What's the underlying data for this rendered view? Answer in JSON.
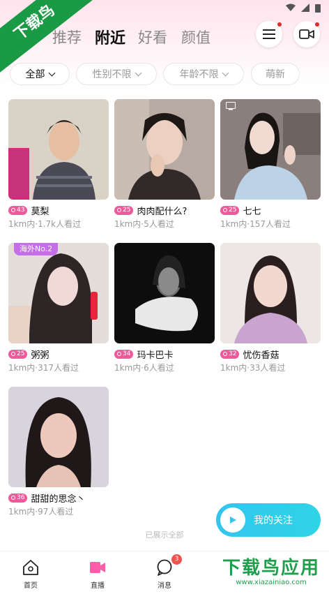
{
  "watermark_top": "下载鸟",
  "tabs": [
    "推荐",
    "附近",
    "好看",
    "颜值"
  ],
  "active_tab": "附近",
  "filters": [
    {
      "label": "全部",
      "active": true
    },
    {
      "label": "性别不限",
      "active": false
    },
    {
      "label": "年龄不限",
      "active": false
    },
    {
      "label": "萌新",
      "active": false
    }
  ],
  "cards": [
    {
      "name": "莫梨",
      "level": "43",
      "meta": "1km内·1.7k人看过",
      "tag": ""
    },
    {
      "name": "肉肉配什么?",
      "level": "25",
      "meta": "1km内·5人看过",
      "tag": ""
    },
    {
      "name": "七七",
      "level": "25",
      "meta": "1km内·157人看过",
      "tag": ""
    },
    {
      "name": "粥粥",
      "level": "25",
      "meta": "1km内·317人看过",
      "tag": "海外No.2"
    },
    {
      "name": "玛卡巴卡",
      "level": "34",
      "meta": "1km内·6人看过",
      "tag": ""
    },
    {
      "name": "忧伤香菇",
      "level": "32",
      "meta": "1km内·33人看过",
      "tag": ""
    },
    {
      "name": "甜甜的思念丶",
      "level": "36",
      "meta": "1km内·97人看过",
      "tag": ""
    }
  ],
  "end_text": "已展示全部",
  "follow_label": "我的关注",
  "nav": [
    {
      "label": "首页",
      "icon": "home-icon"
    },
    {
      "label": "直播",
      "icon": "video-camera-icon"
    },
    {
      "label": "消息",
      "icon": "chat-bubble-icon",
      "badge": "3"
    }
  ],
  "watermark_bottom": {
    "big": "下载鸟应用",
    "small": "www.xiazainiao.com"
  },
  "colors": {
    "accent": "#f05a9a",
    "follow": "#34c4ee",
    "watermark": "#1e9f4c",
    "badge": "#f0524f"
  }
}
